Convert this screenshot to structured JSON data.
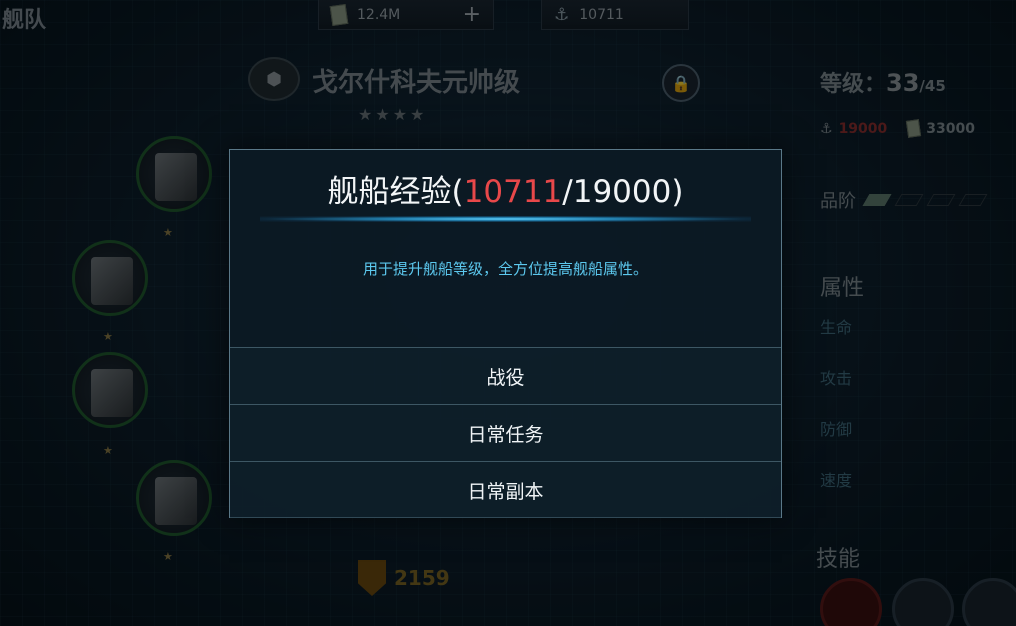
{
  "header": {
    "title": "舰队",
    "money": "12.4M",
    "anchor_value": "10711",
    "plus": "+"
  },
  "ship": {
    "name": "戈尔什科夫元帅级",
    "stars": "★★★★",
    "level_label": "等级：",
    "level": "33",
    "level_max": "/45",
    "cost_anchor": "19000",
    "cost_money": "33000",
    "rank_label": "品阶",
    "power": "2159"
  },
  "attributes": {
    "title": "属性",
    "items": [
      "生命",
      "攻击",
      "防御",
      "速度"
    ]
  },
  "skills": {
    "title": "技能"
  },
  "dialog": {
    "title_prefix": "舰船经验(",
    "exp_current": "10711",
    "exp_rest": "/19000)",
    "description": "用于提升舰船等级，全方位提高舰船属性。",
    "options": [
      "战役",
      "日常任务",
      "日常副本"
    ]
  },
  "colors": {
    "accent_cyan": "#5cc8ee",
    "exp_red": "#e8484a",
    "dialog_border": "#5a7888"
  }
}
